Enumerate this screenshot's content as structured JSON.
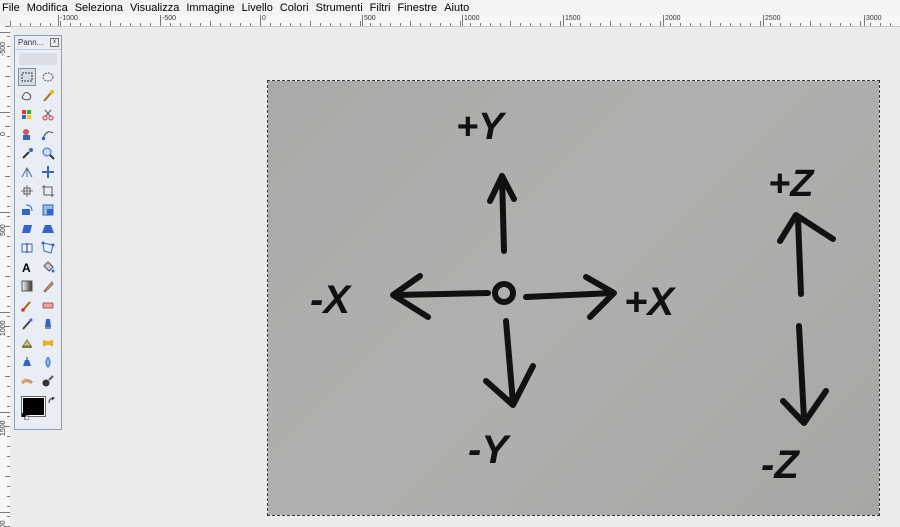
{
  "menu": [
    "File",
    "Modifica",
    "Seleziona",
    "Visualizza",
    "Immagine",
    "Livello",
    "Colori",
    "Strumenti",
    "Filtri",
    "Finestre",
    "Aiuto"
  ],
  "ruler": {
    "h_labels": [
      "-1000",
      "-500",
      "0",
      "500",
      "1000",
      "1500",
      "2000",
      "2500",
      "3000"
    ],
    "v_labels": [
      "-500",
      "0",
      "500",
      "1000",
      "1500",
      "2000"
    ]
  },
  "toolbox": {
    "title": "Pann...",
    "close": "x",
    "tools": [
      "rect-select-icon",
      "ellipse-select-icon",
      "free-select-icon",
      "fuzzy-select-icon",
      "color-select-icon",
      "scissors-select-icon",
      "foreground-select-icon",
      "paths-icon",
      "color-picker-icon",
      "zoom-icon",
      "measure-icon",
      "move-icon",
      "align-icon",
      "crop-icon",
      "rotate-icon",
      "scale-icon",
      "shear-icon",
      "perspective-icon",
      "flip-icon",
      "cage-icon",
      "text-icon",
      "bucket-fill-icon",
      "blend-icon",
      "pencil-icon",
      "paintbrush-icon",
      "eraser-icon",
      "airbrush-icon",
      "ink-icon",
      "clone-icon",
      "heal-icon",
      "perspective-clone-icon",
      "blur-icon",
      "smudge-icon",
      "dodge-burn-icon"
    ],
    "fg_color": "#000000"
  },
  "image": {
    "labels": {
      "plus_y": "+Y",
      "minus_x": "-X",
      "plus_x": "+X",
      "minus_y": "-Y",
      "plus_z": "+Z",
      "minus_z": "-Z",
      "origin": "O"
    },
    "ink_color": "#111111",
    "background": "#abacaa"
  }
}
